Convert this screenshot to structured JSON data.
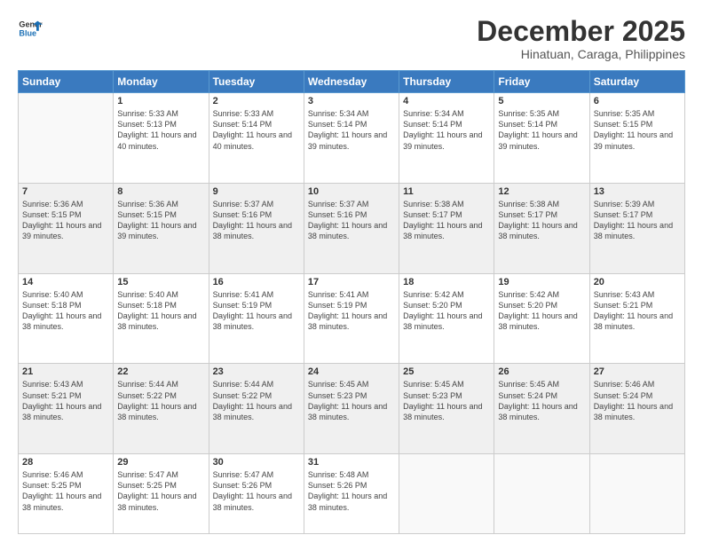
{
  "logo": {
    "line1": "General",
    "line2": "Blue"
  },
  "title": "December 2025",
  "subtitle": "Hinatuan, Caraga, Philippines",
  "weekdays": [
    "Sunday",
    "Monday",
    "Tuesday",
    "Wednesday",
    "Thursday",
    "Friday",
    "Saturday"
  ],
  "weeks": [
    [
      {
        "day": "",
        "sunrise": "",
        "sunset": "",
        "daylight": ""
      },
      {
        "day": "1",
        "sunrise": "Sunrise: 5:33 AM",
        "sunset": "Sunset: 5:13 PM",
        "daylight": "Daylight: 11 hours and 40 minutes."
      },
      {
        "day": "2",
        "sunrise": "Sunrise: 5:33 AM",
        "sunset": "Sunset: 5:14 PM",
        "daylight": "Daylight: 11 hours and 40 minutes."
      },
      {
        "day": "3",
        "sunrise": "Sunrise: 5:34 AM",
        "sunset": "Sunset: 5:14 PM",
        "daylight": "Daylight: 11 hours and 39 minutes."
      },
      {
        "day": "4",
        "sunrise": "Sunrise: 5:34 AM",
        "sunset": "Sunset: 5:14 PM",
        "daylight": "Daylight: 11 hours and 39 minutes."
      },
      {
        "day": "5",
        "sunrise": "Sunrise: 5:35 AM",
        "sunset": "Sunset: 5:14 PM",
        "daylight": "Daylight: 11 hours and 39 minutes."
      },
      {
        "day": "6",
        "sunrise": "Sunrise: 5:35 AM",
        "sunset": "Sunset: 5:15 PM",
        "daylight": "Daylight: 11 hours and 39 minutes."
      }
    ],
    [
      {
        "day": "7",
        "sunrise": "Sunrise: 5:36 AM",
        "sunset": "Sunset: 5:15 PM",
        "daylight": "Daylight: 11 hours and 39 minutes."
      },
      {
        "day": "8",
        "sunrise": "Sunrise: 5:36 AM",
        "sunset": "Sunset: 5:15 PM",
        "daylight": "Daylight: 11 hours and 39 minutes."
      },
      {
        "day": "9",
        "sunrise": "Sunrise: 5:37 AM",
        "sunset": "Sunset: 5:16 PM",
        "daylight": "Daylight: 11 hours and 38 minutes."
      },
      {
        "day": "10",
        "sunrise": "Sunrise: 5:37 AM",
        "sunset": "Sunset: 5:16 PM",
        "daylight": "Daylight: 11 hours and 38 minutes."
      },
      {
        "day": "11",
        "sunrise": "Sunrise: 5:38 AM",
        "sunset": "Sunset: 5:17 PM",
        "daylight": "Daylight: 11 hours and 38 minutes."
      },
      {
        "day": "12",
        "sunrise": "Sunrise: 5:38 AM",
        "sunset": "Sunset: 5:17 PM",
        "daylight": "Daylight: 11 hours and 38 minutes."
      },
      {
        "day": "13",
        "sunrise": "Sunrise: 5:39 AM",
        "sunset": "Sunset: 5:17 PM",
        "daylight": "Daylight: 11 hours and 38 minutes."
      }
    ],
    [
      {
        "day": "14",
        "sunrise": "Sunrise: 5:40 AM",
        "sunset": "Sunset: 5:18 PM",
        "daylight": "Daylight: 11 hours and 38 minutes."
      },
      {
        "day": "15",
        "sunrise": "Sunrise: 5:40 AM",
        "sunset": "Sunset: 5:18 PM",
        "daylight": "Daylight: 11 hours and 38 minutes."
      },
      {
        "day": "16",
        "sunrise": "Sunrise: 5:41 AM",
        "sunset": "Sunset: 5:19 PM",
        "daylight": "Daylight: 11 hours and 38 minutes."
      },
      {
        "day": "17",
        "sunrise": "Sunrise: 5:41 AM",
        "sunset": "Sunset: 5:19 PM",
        "daylight": "Daylight: 11 hours and 38 minutes."
      },
      {
        "day": "18",
        "sunrise": "Sunrise: 5:42 AM",
        "sunset": "Sunset: 5:20 PM",
        "daylight": "Daylight: 11 hours and 38 minutes."
      },
      {
        "day": "19",
        "sunrise": "Sunrise: 5:42 AM",
        "sunset": "Sunset: 5:20 PM",
        "daylight": "Daylight: 11 hours and 38 minutes."
      },
      {
        "day": "20",
        "sunrise": "Sunrise: 5:43 AM",
        "sunset": "Sunset: 5:21 PM",
        "daylight": "Daylight: 11 hours and 38 minutes."
      }
    ],
    [
      {
        "day": "21",
        "sunrise": "Sunrise: 5:43 AM",
        "sunset": "Sunset: 5:21 PM",
        "daylight": "Daylight: 11 hours and 38 minutes."
      },
      {
        "day": "22",
        "sunrise": "Sunrise: 5:44 AM",
        "sunset": "Sunset: 5:22 PM",
        "daylight": "Daylight: 11 hours and 38 minutes."
      },
      {
        "day": "23",
        "sunrise": "Sunrise: 5:44 AM",
        "sunset": "Sunset: 5:22 PM",
        "daylight": "Daylight: 11 hours and 38 minutes."
      },
      {
        "day": "24",
        "sunrise": "Sunrise: 5:45 AM",
        "sunset": "Sunset: 5:23 PM",
        "daylight": "Daylight: 11 hours and 38 minutes."
      },
      {
        "day": "25",
        "sunrise": "Sunrise: 5:45 AM",
        "sunset": "Sunset: 5:23 PM",
        "daylight": "Daylight: 11 hours and 38 minutes."
      },
      {
        "day": "26",
        "sunrise": "Sunrise: 5:45 AM",
        "sunset": "Sunset: 5:24 PM",
        "daylight": "Daylight: 11 hours and 38 minutes."
      },
      {
        "day": "27",
        "sunrise": "Sunrise: 5:46 AM",
        "sunset": "Sunset: 5:24 PM",
        "daylight": "Daylight: 11 hours and 38 minutes."
      }
    ],
    [
      {
        "day": "28",
        "sunrise": "Sunrise: 5:46 AM",
        "sunset": "Sunset: 5:25 PM",
        "daylight": "Daylight: 11 hours and 38 minutes."
      },
      {
        "day": "29",
        "sunrise": "Sunrise: 5:47 AM",
        "sunset": "Sunset: 5:25 PM",
        "daylight": "Daylight: 11 hours and 38 minutes."
      },
      {
        "day": "30",
        "sunrise": "Sunrise: 5:47 AM",
        "sunset": "Sunset: 5:26 PM",
        "daylight": "Daylight: 11 hours and 38 minutes."
      },
      {
        "day": "31",
        "sunrise": "Sunrise: 5:48 AM",
        "sunset": "Sunset: 5:26 PM",
        "daylight": "Daylight: 11 hours and 38 minutes."
      },
      {
        "day": "",
        "sunrise": "",
        "sunset": "",
        "daylight": ""
      },
      {
        "day": "",
        "sunrise": "",
        "sunset": "",
        "daylight": ""
      },
      {
        "day": "",
        "sunrise": "",
        "sunset": "",
        "daylight": ""
      }
    ]
  ]
}
